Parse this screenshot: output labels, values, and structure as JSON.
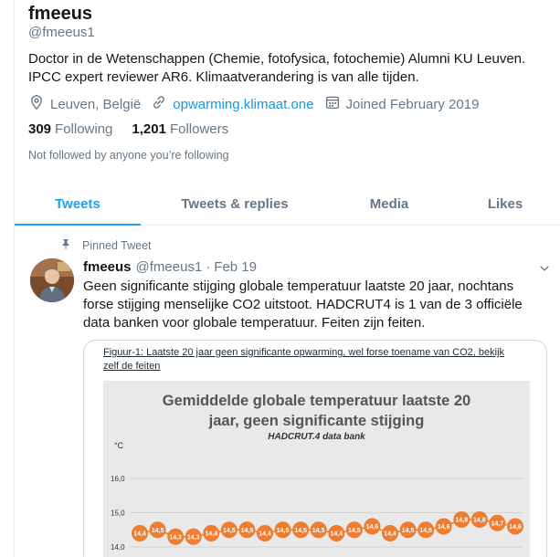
{
  "profile": {
    "name": "fmeeus",
    "handle": "@fmeeus1",
    "bio_line1": "Doctor in de Wetenschappen (Chemie, fotofysica, fotochemie) Alumni KU Leuven.",
    "bio_line2": "IPCC expert reviewer AR6. Klimaatverandering is van alle tijden.",
    "location": "Leuven, België",
    "website": "opwarming.klimaat.one",
    "joined": "Joined February 2019",
    "following_count": "309",
    "following_label": "Following",
    "followers_count": "1,201",
    "followers_label": "Followers",
    "not_followed": "Not followed by anyone you’re following"
  },
  "tabs": [
    {
      "label": "Tweets",
      "active": true
    },
    {
      "label": "Tweets & replies",
      "active": false
    },
    {
      "label": "Media",
      "active": false
    },
    {
      "label": "Likes",
      "active": false
    }
  ],
  "tweet": {
    "pinned_label": "Pinned Tweet",
    "author": "fmeeus",
    "handle": "@fmeeus1",
    "separator": "·",
    "date": "Feb 19",
    "text_line1": "Geen significante stijging globale temperatuur laatste 20 jaar, nochtans",
    "text_line2": "forse stijging menselijke CO2 uitstoot. HADCRUT4 is 1 van de 3 officiële",
    "text_line3": "data banken voor globale temperatuur. Feiten zijn feiten.",
    "figure_caption_line1": "Figuur-1: Laatste 20 jaar geen significante opwarming, wel forse toename van CO2, bekijk",
    "figure_caption_line2": "zelf de feiten"
  },
  "icons": {
    "location": "location-pin-icon",
    "link": "link-icon",
    "calendar": "calendar-icon",
    "pin": "pin-icon",
    "caret": "chevron-down-icon"
  },
  "colors": {
    "accent": "#1da1f2",
    "link": "#1b95e0",
    "muted": "#657786",
    "series": "#ed7d31"
  },
  "chart_data": {
    "type": "line",
    "title_line1": "Gemiddelde globale temperatuur laatste 20",
    "title_line2": "jaar, geen significante stijging",
    "subtitle": "HADCRUT.4 data bank",
    "ylabel": "°C",
    "yticks": [
      "16,0",
      "15,0",
      "14,0"
    ],
    "ylim": [
      14.0,
      16.0
    ],
    "grid": true,
    "point_labels": [
      "14,4",
      "14,5",
      "14,3",
      "14,3",
      "14,4",
      "14,5",
      "14,5",
      "14,4",
      "14,5",
      "14,5",
      "14,5",
      "14,4",
      "14,5",
      "14,6",
      "14,4",
      "14,5",
      "14,5",
      "14,6",
      "14,8",
      "14,8",
      "14,7",
      "14,6"
    ],
    "values": [
      14.4,
      14.5,
      14.3,
      14.3,
      14.4,
      14.5,
      14.5,
      14.4,
      14.5,
      14.5,
      14.5,
      14.4,
      14.5,
      14.6,
      14.4,
      14.5,
      14.5,
      14.6,
      14.8,
      14.8,
      14.7,
      14.6
    ]
  }
}
